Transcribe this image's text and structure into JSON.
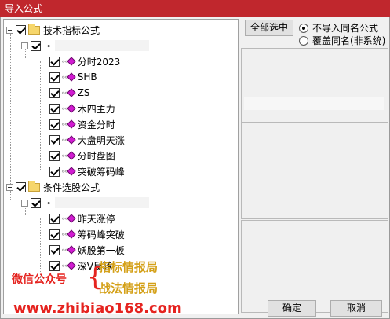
{
  "window": {
    "title": "导入公式"
  },
  "tree": {
    "group1": {
      "label": "技术指标公式",
      "items": [
        "分时2023",
        "SHB",
        "ZS",
        "木四主力",
        "资金分时",
        "大盘明天涨",
        "分时盘图",
        "突破筹码峰"
      ]
    },
    "group2": {
      "label": "条件选股公式",
      "items": [
        "昨天涨停",
        "筹码峰突破",
        "妖股第一板",
        "深V反转"
      ]
    }
  },
  "toolbar": {
    "select_all_label": "全部选中"
  },
  "options": {
    "no_import_label": "不导入同名公式",
    "overwrite_label": "覆盖同名(非系统)",
    "selected": "no_import"
  },
  "buttons": {
    "ok_label": "确定",
    "cancel_label": "取消"
  },
  "watermark": {
    "wechat_label": "微信公众号",
    "name1": "指标情报局",
    "name2": "战法情报局",
    "url": "www.zhibiao168.com"
  },
  "colors": {
    "titlebar": "#c0272d",
    "watermark_red": "#e5231f",
    "watermark_gold": "#d4a017",
    "gem": "#d21bd2"
  }
}
